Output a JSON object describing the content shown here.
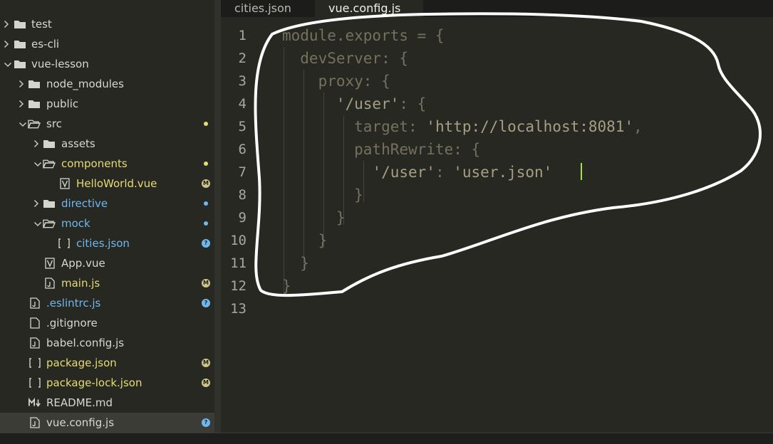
{
  "sidebar": {
    "items": [
      {
        "label": "test",
        "icon": "folder-closed-icon",
        "expand": "collapsed"
      },
      {
        "label": "es-cli",
        "icon": "folder-closed-icon",
        "expand": "collapsed"
      },
      {
        "label": "vue-lesson",
        "icon": "folder-closed-icon",
        "expand": "expanded"
      },
      {
        "label": "node_modules",
        "icon": "folder-closed-icon",
        "expand": "collapsed"
      },
      {
        "label": "public",
        "icon": "folder-closed-icon",
        "expand": "collapsed"
      },
      {
        "label": "src",
        "icon": "folder-open-icon",
        "expand": "expanded",
        "badge": "dot-yellow"
      },
      {
        "label": "assets",
        "icon": "folder-closed-icon",
        "expand": "collapsed"
      },
      {
        "label": "components",
        "icon": "folder-open-icon",
        "expand": "expanded",
        "badge": "dot-yellow",
        "color": "yellow"
      },
      {
        "label": "HelloWorld.vue",
        "icon": "vue-file-icon",
        "badge": "M",
        "color": "yellow"
      },
      {
        "label": "directive",
        "icon": "folder-closed-icon",
        "expand": "collapsed",
        "badge": "dot-blue",
        "color": "blue"
      },
      {
        "label": "mock",
        "icon": "folder-open-icon",
        "expand": "expanded",
        "badge": "dot-blue",
        "color": "blue"
      },
      {
        "label": "cities.json",
        "icon": "json-file-icon",
        "badge": "?",
        "color": "blue"
      },
      {
        "label": "App.vue",
        "icon": "vue-file-icon"
      },
      {
        "label": "main.js",
        "icon": "js-file-icon",
        "badge": "M",
        "color": "yellow"
      },
      {
        "label": ".eslintrc.js",
        "icon": "js-file-icon",
        "badge": "?",
        "color": "blue"
      },
      {
        "label": ".gitignore",
        "icon": "file-icon"
      },
      {
        "label": "babel.config.js",
        "icon": "js-file-icon"
      },
      {
        "label": "package.json",
        "icon": "json-file-icon",
        "badge": "M",
        "color": "yellow"
      },
      {
        "label": "package-lock.json",
        "icon": "json-file-icon",
        "badge": "M",
        "color": "yellow"
      },
      {
        "label": "README.md",
        "icon": "markdown-file-icon"
      },
      {
        "label": "vue.config.js",
        "icon": "js-file-icon",
        "badge": "?",
        "selected": true
      }
    ]
  },
  "tabs": [
    {
      "label": "cities.json",
      "active": false
    },
    {
      "label": "vue.config.js",
      "active": true
    }
  ],
  "editor": {
    "line_numbers": [
      "1",
      "2",
      "3",
      "4",
      "5",
      "6",
      "7",
      "8",
      "9",
      "10",
      "11",
      "12",
      "13"
    ],
    "lines": [
      {
        "plain": "module.exports = {"
      },
      {
        "plain": "  devServer: {"
      },
      {
        "plain": "    proxy: {"
      },
      {
        "pre": "      ",
        "str": "'/user'",
        "post": ": {"
      },
      {
        "pre": "        target: ",
        "str": "'http://localhost:8081'",
        "post": ","
      },
      {
        "pre": "        pathRewrite: {"
      },
      {
        "pre": "          ",
        "str": "'/user'",
        "mid": ": ",
        "str2": "'user.json'"
      },
      {
        "plain": "        }"
      },
      {
        "plain": "      }"
      },
      {
        "plain": "    }"
      },
      {
        "plain": "  }"
      },
      {
        "plain": "}"
      },
      {
        "plain": ""
      }
    ]
  },
  "colors": {
    "background": "#272822",
    "highlight_yellow": "#e6db74",
    "highlight_blue": "#6fb8ee",
    "cursor": "#a6e22e",
    "annotation": "#ffffff"
  }
}
